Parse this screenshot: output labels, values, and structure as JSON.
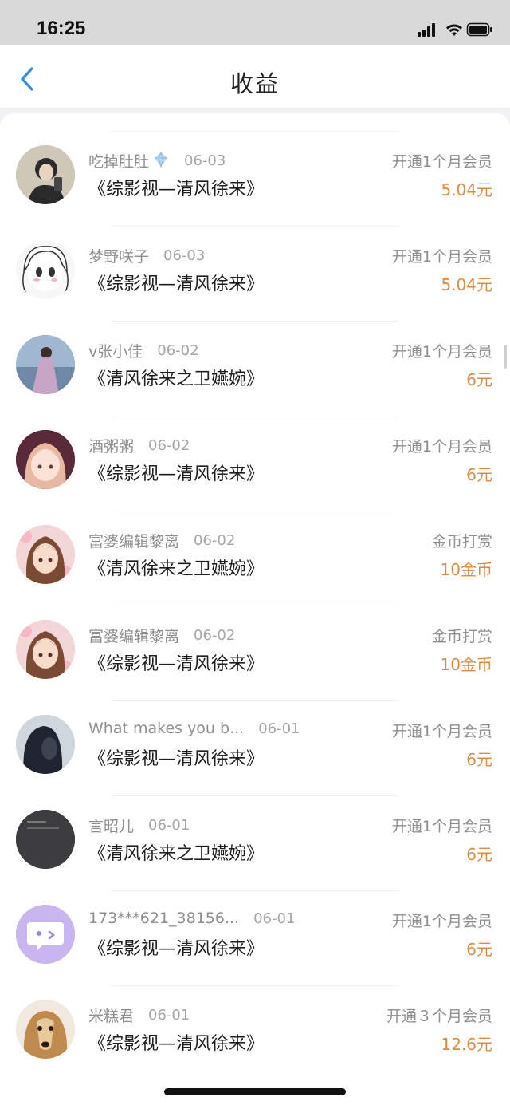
{
  "status_bar": {
    "time": "16:25"
  },
  "header": {
    "title": "收益"
  },
  "colors": {
    "accent": "#2f8fe0",
    "amount": "#e08b43",
    "muted": "#8f8f8f"
  },
  "items": [
    {
      "user": "吃掉肚肚",
      "badge": "diamond-icon",
      "date": "06-03",
      "book": "《综影视—清风徐来》",
      "type": "开通1个月会员",
      "amount": "5.04元",
      "avatar": "avatar-girl-selfie"
    },
    {
      "user": "梦野咲子",
      "date": "06-03",
      "book": "《综影视—清风徐来》",
      "type": "开通1个月会员",
      "amount": "5.04元",
      "avatar": "avatar-manga-girl"
    },
    {
      "user": "v张小佳",
      "date": "06-02",
      "book": "《清风徐来之卫嬿婉》",
      "type": "开通1个月会员",
      "amount": "6元",
      "avatar": "avatar-woman-dress"
    },
    {
      "user": "酒粥粥",
      "date": "06-02",
      "book": "《综影视—清风徐来》",
      "type": "开通1个月会员",
      "amount": "6元",
      "avatar": "avatar-anime-girl-pink"
    },
    {
      "user": "富婆编辑黎离",
      "date": "06-02",
      "book": "《清风徐来之卫嬿婉》",
      "type": "金币打赏",
      "amount": "10金币",
      "avatar": "avatar-anime-girl-brown"
    },
    {
      "user": "富婆编辑黎离",
      "date": "06-02",
      "book": "《综影视—清风徐来》",
      "type": "金币打赏",
      "amount": "10金币",
      "avatar": "avatar-anime-girl-brown"
    },
    {
      "user": "What makes you b...",
      "date": "06-01",
      "book": "《综影视—清风徐来》",
      "type": "开通1个月会员",
      "amount": "6元",
      "avatar": "avatar-dark-portrait"
    },
    {
      "user": "言昭儿",
      "date": "06-01",
      "book": "《清风徐来之卫嬿婉》",
      "type": "开通1个月会员",
      "amount": "6元",
      "avatar": "avatar-dark-gray"
    },
    {
      "user": "173***621_38156...",
      "date": "06-01",
      "book": "《综影视—清风徐来》",
      "type": "开通1个月会员",
      "amount": "6元",
      "avatar": "avatar-default-chat"
    },
    {
      "user": "米糕君",
      "date": "06-01",
      "book": "《综影视—清风徐来》",
      "type": "开通３个月会员",
      "amount": "12.6元",
      "avatar": "avatar-dog"
    }
  ]
}
